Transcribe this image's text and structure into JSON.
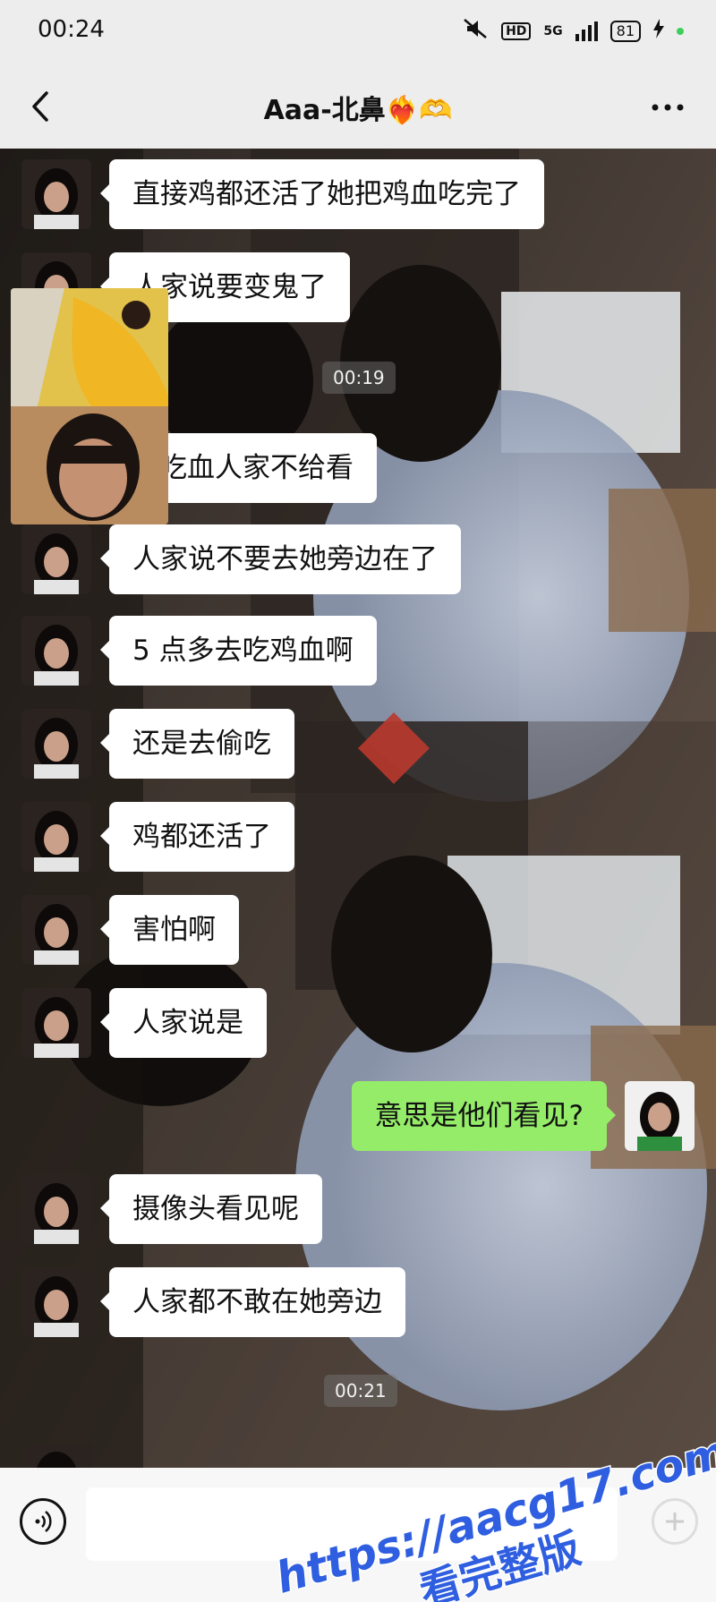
{
  "status_bar": {
    "time": "00:24",
    "battery": "81",
    "network": "5G",
    "hd": "HD"
  },
  "header": {
    "title": "Aaa-北鼻❤️‍🔥🫶"
  },
  "messages": [
    {
      "text": "直接鸡都还活了她把鸡血吃完了",
      "side": "left"
    },
    {
      "text": "人家说要变鬼了",
      "side": "left"
    },
    {
      "text": "吃血人家不给看",
      "side": "left"
    },
    {
      "text": "人家说不要去她旁边在了",
      "side": "left"
    },
    {
      "text": "5 点多去吃鸡血啊",
      "side": "left"
    },
    {
      "text": "还是去偷吃",
      "side": "left"
    },
    {
      "text": "鸡都还活了",
      "side": "left"
    },
    {
      "text": "害怕啊",
      "side": "left"
    },
    {
      "text": "人家说是",
      "side": "left"
    },
    {
      "text": "意思是他们看见?",
      "side": "right"
    },
    {
      "text": "摄像头看见呢",
      "side": "left"
    },
    {
      "text": "人家都不敢在她旁边",
      "side": "left"
    }
  ],
  "timestamps": [
    "00:19",
    "00:21"
  ],
  "watermark": {
    "url": "https://aacg17.com",
    "sub": "看完整版"
  },
  "colors": {
    "sent_bubble": "#95ec69",
    "received_bubble": "#ffffff",
    "chrome": "#ededed"
  },
  "icons": [
    "back-icon",
    "more-icon",
    "voice-icon",
    "plus-icon"
  ]
}
